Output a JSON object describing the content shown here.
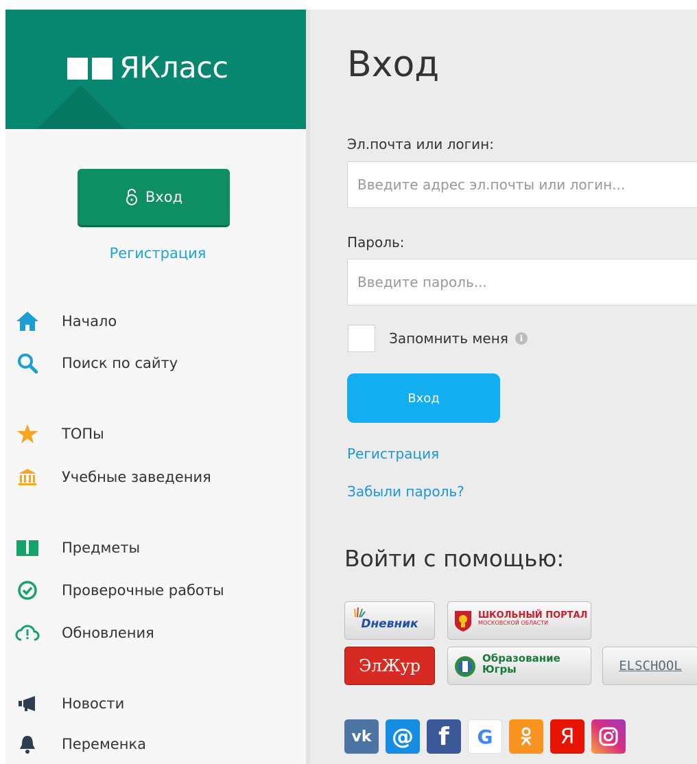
{
  "sidebar": {
    "brand_name": "ЯКласс",
    "login_label": "Вход",
    "register_label": "Регистрация",
    "nav": [
      {
        "label": "Начало",
        "icon": "home-icon"
      },
      {
        "label": "Поиск по сайту",
        "icon": "search-icon"
      },
      {
        "label": "ТОПы",
        "icon": "star-icon"
      },
      {
        "label": "Учебные заведения",
        "icon": "institution-icon"
      },
      {
        "label": "Предметы",
        "icon": "book-icon"
      },
      {
        "label": "Проверочные работы",
        "icon": "check-circle-icon"
      },
      {
        "label": "Обновления",
        "icon": "cloud-update-icon"
      },
      {
        "label": "Новости",
        "icon": "megaphone-icon"
      },
      {
        "label": "Переменка",
        "icon": "bell-icon"
      }
    ]
  },
  "main": {
    "title": "Вход",
    "email_label": "Эл.почта или логин:",
    "email_placeholder": "Введите адрес эл.почты или логин...",
    "password_label": "Пароль:",
    "password_placeholder": "Введите пароль...",
    "remember_label": "Запомнить меня",
    "submit_label": "Вход",
    "register_link": "Регистрация",
    "forgot_link": "Забыли пароль?",
    "social_title": "Войти с помощью:",
    "partners": {
      "dnevnik": "Dневник",
      "school_portal_line1": "ШКОЛЬНЫЙ ПОРТАЛ",
      "school_portal_line2": "МОСКОВСКОЙ ОБЛАСТИ",
      "elzhur": "ЭлЖур",
      "ugra_line1": "Образование",
      "ugra_line2": "Югры",
      "elschool": "ELSCHOOL"
    },
    "social": [
      "vk",
      "mail",
      "facebook",
      "google",
      "odnoklassniki",
      "yandex",
      "instagram"
    ]
  },
  "colors": {
    "brand": "#07876f",
    "login_button": "#0d8e63",
    "submit_button": "#13aef0",
    "link": "#1d96d6"
  }
}
